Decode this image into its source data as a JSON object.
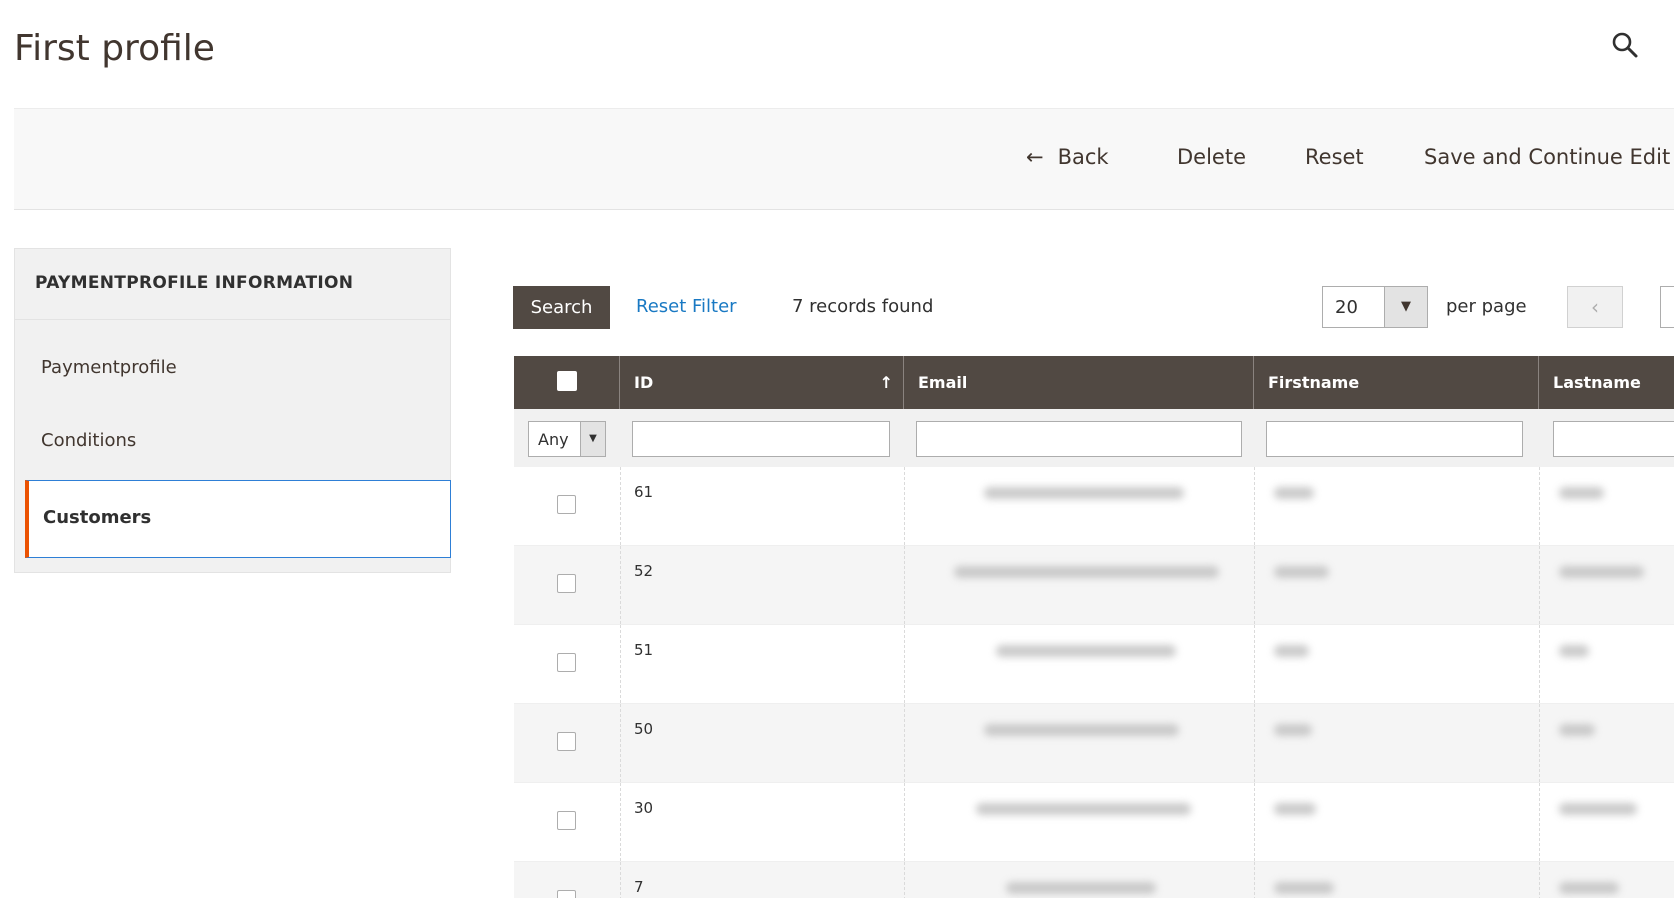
{
  "page": {
    "title": "First profile"
  },
  "actions": {
    "back": "Back",
    "delete": "Delete",
    "reset": "Reset",
    "save_continue": "Save and Continue Edit"
  },
  "sidebar": {
    "heading": "PAYMENTPROFILE INFORMATION",
    "items": [
      {
        "label": "Paymentprofile",
        "active": false
      },
      {
        "label": "Conditions",
        "active": false
      },
      {
        "label": "Customers",
        "active": true
      }
    ]
  },
  "grid_toolbar": {
    "search_label": "Search",
    "reset_filter_label": "Reset Filter",
    "records_found": "7 records found",
    "per_page_value": "20",
    "per_page_label": "per page",
    "prev_glyph": "‹"
  },
  "grid": {
    "columns": [
      "ID",
      "Email",
      "Firstname",
      "Lastname"
    ],
    "filter_any": "Any",
    "rows": [
      {
        "id": "61"
      },
      {
        "id": "52"
      },
      {
        "id": "51"
      },
      {
        "id": "50"
      },
      {
        "id": "30"
      },
      {
        "id": "7"
      }
    ]
  },
  "icons": {
    "search": "search-icon",
    "back_arrow": "arrow-left-icon",
    "sort": "sort-arrow-up-icon",
    "dropdown": "caret-down-icon"
  },
  "colors": {
    "header_bg": "#514943",
    "link": "#1979c3",
    "active_accent": "#eb5202",
    "active_border": "#2e7fd6"
  }
}
